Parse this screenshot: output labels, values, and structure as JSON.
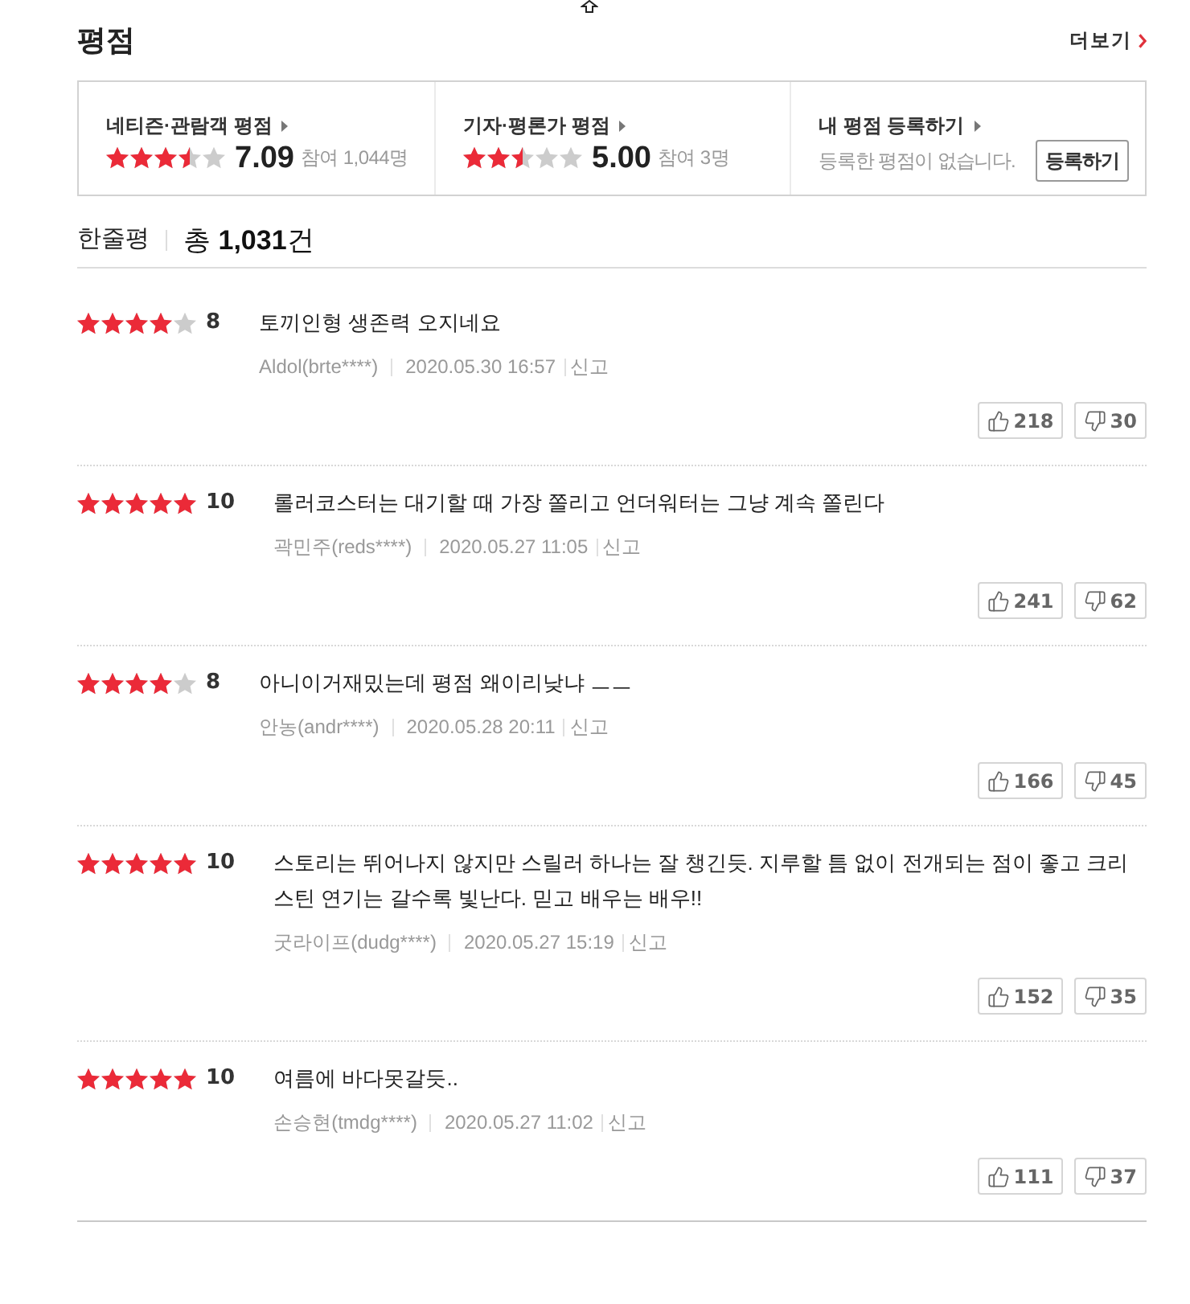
{
  "header": {
    "title": "평점",
    "more_link": "더보기"
  },
  "rating_summary": [
    {
      "kind": "score",
      "label": "네티즌·관람객 평점",
      "stars": 3.5,
      "score": "7.09",
      "participants": "참여 1,044명"
    },
    {
      "kind": "score",
      "label": "기자·평론가 평점",
      "stars": 2.5,
      "score": "5.00",
      "participants": "참여 3명"
    },
    {
      "kind": "register",
      "label": "내 평점 등록하기",
      "message": "등록한 평점이 없습니다.",
      "button": "등록하기"
    }
  ],
  "review_section": {
    "title": "한줄평",
    "total": "총 **1,031**건"
  },
  "reviews": [
    {
      "stars": 4,
      "score": "8",
      "text": "토끼인형 생존력 오지네요",
      "author": "Aldol(brte****)",
      "date": "2020.05.30 16:57",
      "report": "신고",
      "likes": "218",
      "dislikes": "30"
    },
    {
      "stars": 5,
      "score": "10",
      "text": "롤러코스터는 대기할 때 가장 쫄리고 언더워터는 그냥 계속 쫄린다",
      "author": "곽민주(reds****)",
      "date": "2020.05.27 11:05",
      "report": "신고",
      "likes": "241",
      "dislikes": "62"
    },
    {
      "stars": 4,
      "score": "8",
      "text": "아니이거재밌는데 평점 왜이리낮냐 ㅡㅡ",
      "author": "안농(andr****)",
      "date": "2020.05.28 20:11",
      "report": "신고",
      "likes": "166",
      "dislikes": "45"
    },
    {
      "stars": 5,
      "score": "10",
      "text": "스토리는 뛰어나지 않지만 스릴러 하나는 잘 챙긴듯. 지루할 틈 없이 전개되는 점이 좋고 크리스틴 연기는 갈수록 빛난다. 믿고 배우는 배우!!",
      "author": "굿라이프(dudg****)",
      "date": "2020.05.27 15:19",
      "report": "신고",
      "likes": "152",
      "dislikes": "35"
    },
    {
      "stars": 5,
      "score": "10",
      "text": "여름에 바다못갈듯..",
      "author": "손승현(tmdg****)",
      "date": "2020.05.27 11:02",
      "report": "신고",
      "likes": "111",
      "dislikes": "37"
    }
  ]
}
